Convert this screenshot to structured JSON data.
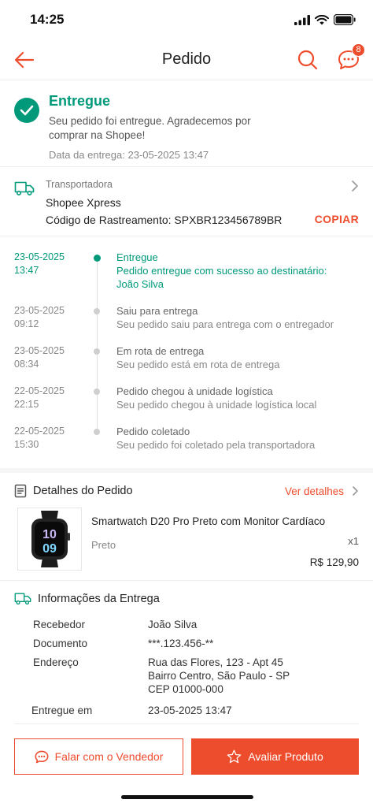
{
  "status_bar": {
    "time": "14:25"
  },
  "nav": {
    "title": "Pedido",
    "chat_badge": "8"
  },
  "delivery_status": {
    "title": "Entregue",
    "message": "Seu pedido foi entregue. Agradecemos por comprar na Shopee!",
    "date": "Data da entrega: 23-05-2025 13:47"
  },
  "carrier": {
    "label": "Transportadora",
    "name": "Shopee Xpress",
    "tracking": "Código de Rastreamento: SPXBR123456789BR",
    "copy_label": "COPIAR"
  },
  "timeline": [
    {
      "date": "23-05-2025",
      "time": "13:47",
      "title": "Entregue",
      "desc": "Pedido entregue com sucesso ao destinatário: João Silva"
    },
    {
      "date": "23-05-2025",
      "time": "09:12",
      "title": "Saiu para entrega",
      "desc": "Seu pedido saiu para entrega com o entregador"
    },
    {
      "date": "23-05-2025",
      "time": "08:34",
      "title": "Em rota de entrega",
      "desc": "Seu pedido está em rota de entrega"
    },
    {
      "date": "22-05-2025",
      "time": "22:15",
      "title": "Pedido chegou à unidade logística",
      "desc": "Seu pedido chegou à unidade logística local"
    },
    {
      "date": "22-05-2025",
      "time": "15:30",
      "title": "Pedido coletado",
      "desc": "Seu pedido foi coletado pela transportadora"
    }
  ],
  "order_details": {
    "title": "Detalhes do Pedido",
    "link": "Ver detalhes",
    "product": {
      "name": "Smartwatch D20 Pro Preto com Monitor Cardíaco",
      "variant": "Preto",
      "qty": "x1",
      "price": "R$ 129,90",
      "watch_face_hour": "10",
      "watch_face_min": "09"
    }
  },
  "delivery_info": {
    "title": "Informações da Entrega",
    "rows": [
      {
        "label": "Recebedor",
        "value": "João Silva"
      },
      {
        "label": "Documento",
        "value": "***.123.456-**"
      },
      {
        "label": "Endereço",
        "value": "Rua das Flores, 123 - Apt 45"
      },
      {
        "label": "",
        "value": "Bairro Centro, São Paulo - SP"
      },
      {
        "label": "",
        "value": "CEP 01000-000"
      },
      {
        "label": "Entregue em",
        "value": "23-05-2025 13:47"
      }
    ]
  },
  "actions": {
    "chat_seller": "Falar com o Vendedor",
    "rate_product": "Avaliar Produto"
  },
  "colors": {
    "accent": "#ee4d2d",
    "success": "#00997a"
  }
}
